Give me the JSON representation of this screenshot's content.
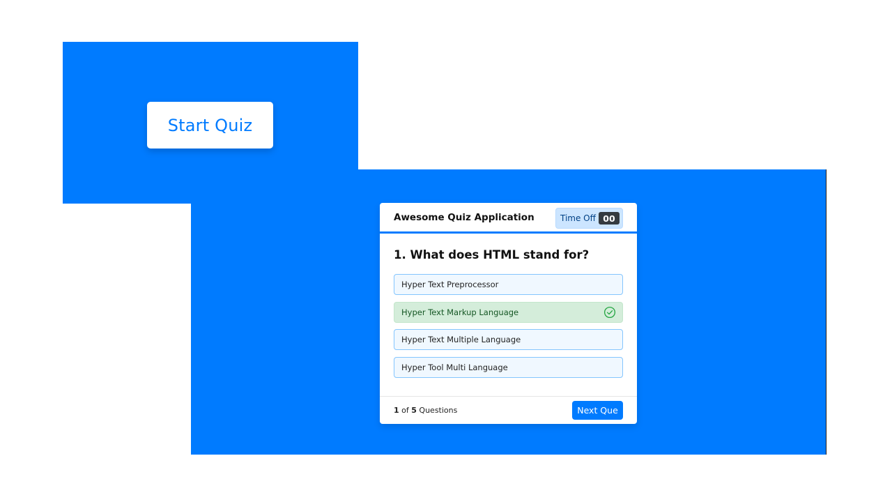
{
  "start_panel": {
    "start_button_label": "Start Quiz"
  },
  "quiz": {
    "title": "Awesome Quiz Application",
    "timer": {
      "label": "Time Off",
      "seconds": "00"
    },
    "question": {
      "number": "1.",
      "text": "What does HTML stand for?"
    },
    "options": [
      {
        "label": "Hyper Text Preprocessor",
        "state": "default"
      },
      {
        "label": "Hyper Text Markup Language",
        "state": "correct",
        "icon": "check-circle-icon"
      },
      {
        "label": "Hyper Text Multiple Language",
        "state": "default"
      },
      {
        "label": "Hyper Tool Multi Language",
        "state": "default"
      }
    ],
    "footer": {
      "current": "1",
      "of_text": "of",
      "total": "5",
      "suffix": "Questions",
      "next_label": "Next Que"
    }
  },
  "colors": {
    "primary": "#007bff",
    "correct_bg": "#d4edda",
    "correct_text": "#155724",
    "option_bg": "#f0f8ff",
    "timer_bg": "#cce5ff"
  }
}
